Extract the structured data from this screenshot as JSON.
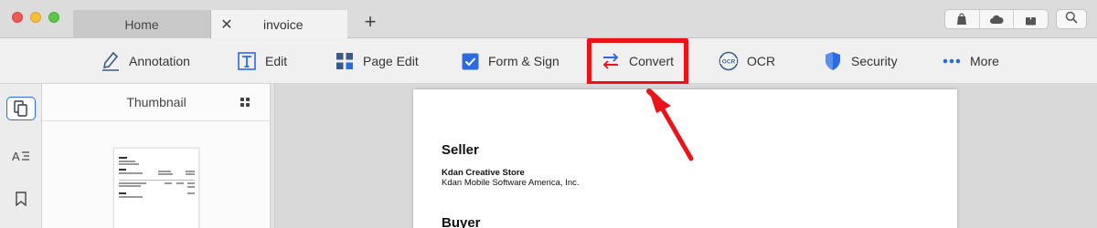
{
  "window": {
    "tabs": [
      {
        "label": "Home"
      },
      {
        "label": "invoice",
        "close": "✕"
      }
    ],
    "new_tab": "+",
    "right_icons": [
      "bag-icon",
      "cloud-icon",
      "share-icon",
      "search-icon"
    ]
  },
  "toolbar": {
    "items": [
      {
        "label": "Annotation",
        "icon": "pen-icon"
      },
      {
        "label": "Edit",
        "icon": "text-box-icon"
      },
      {
        "label": "Page Edit",
        "icon": "grid-icon"
      },
      {
        "label": "Form & Sign",
        "icon": "checkbox-icon"
      },
      {
        "label": "Convert",
        "icon": "convert-arrows-icon"
      },
      {
        "label": "OCR",
        "icon": "ocr-icon"
      },
      {
        "label": "Security",
        "icon": "shield-icon"
      },
      {
        "label": "More",
        "icon": "ellipsis-icon"
      }
    ],
    "highlighted": "Convert",
    "highlight_color": "#e8141a"
  },
  "sidebar": {
    "items": [
      "pages-icon",
      "outline-icon",
      "bookmark-icon"
    ],
    "active": "pages-icon"
  },
  "thumbnail_panel": {
    "title": "Thumbnail"
  },
  "document": {
    "seller_heading": "Seller",
    "seller_name": "Kdan Creative Store",
    "seller_company": "Kdan Mobile Software America, Inc.",
    "buyer_heading": "Buyer"
  },
  "colors": {
    "accent_blue": "#2d6ae0",
    "annotation_red": "#e8141a"
  }
}
